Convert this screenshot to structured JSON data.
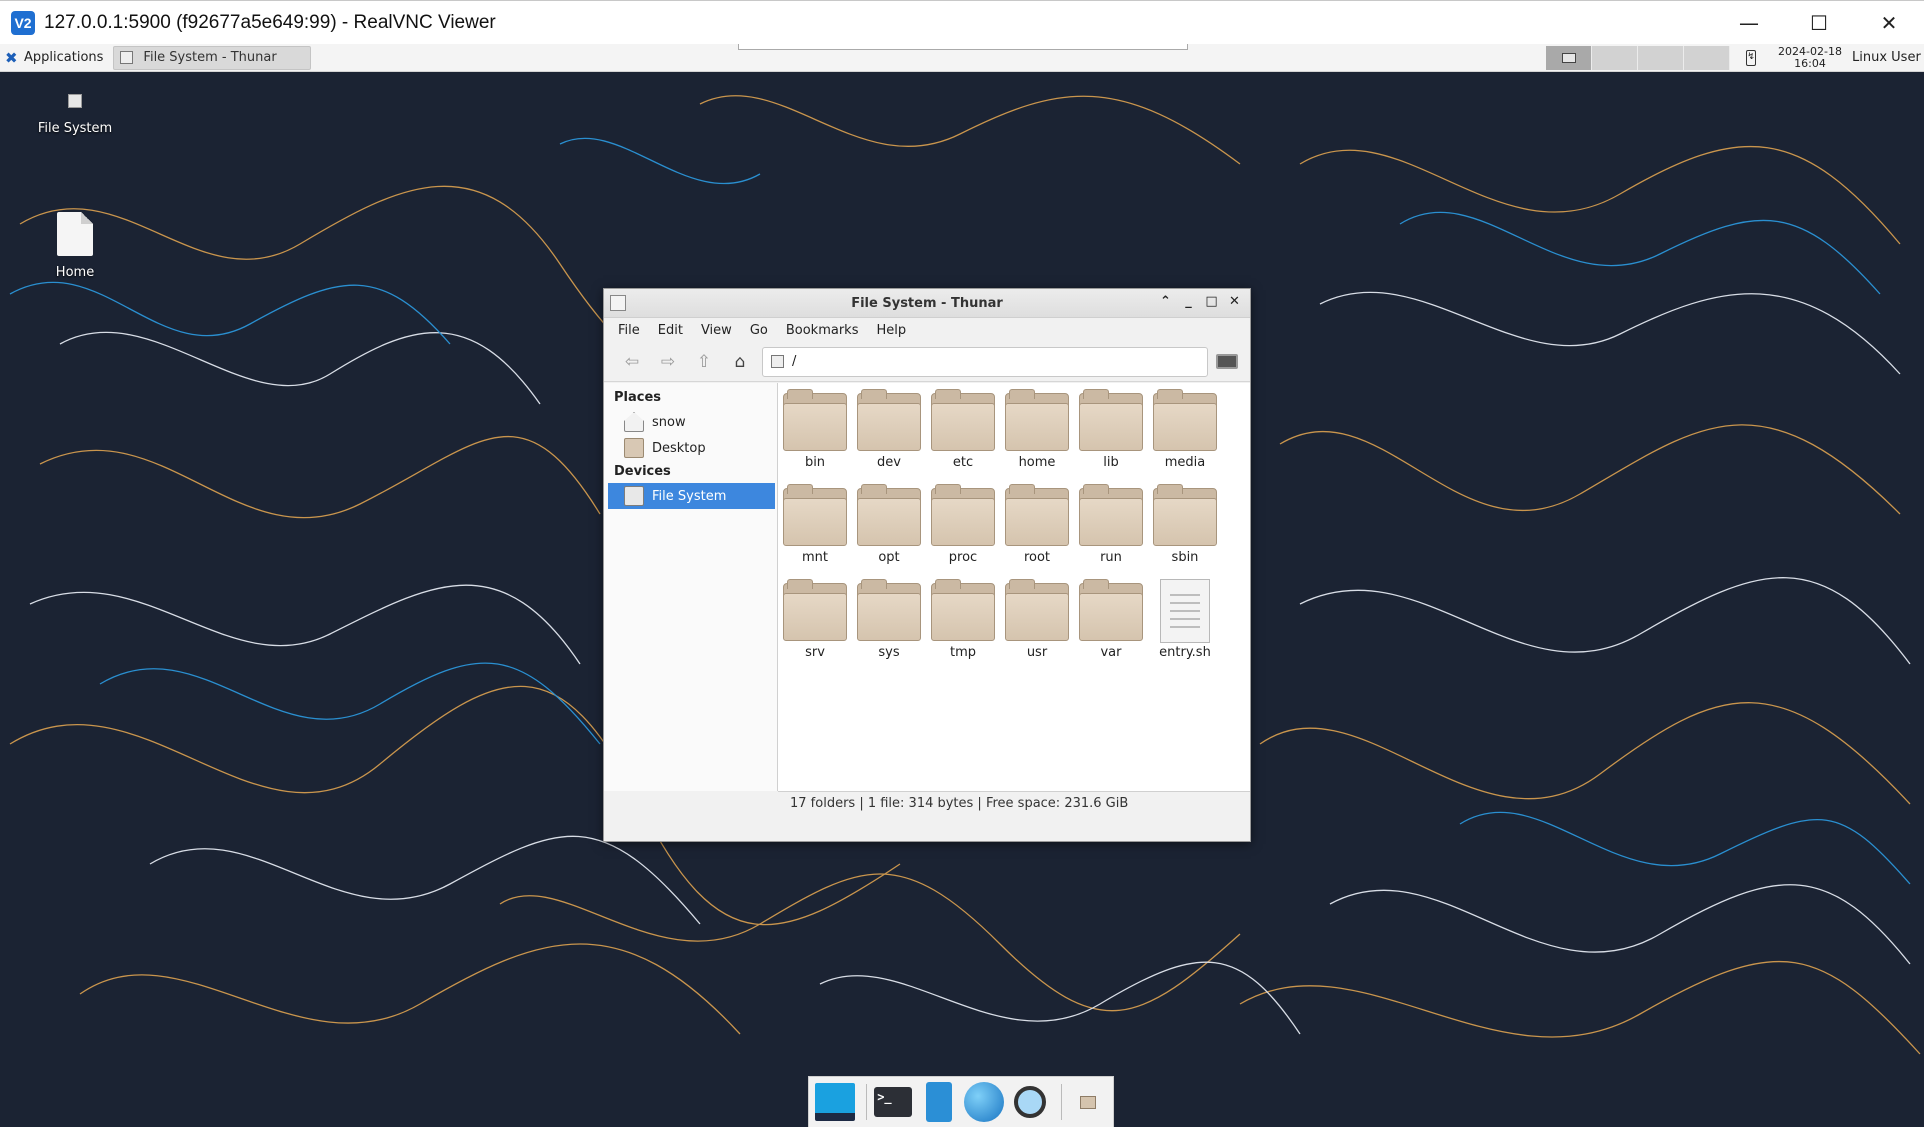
{
  "vnc": {
    "title": "127.0.0.1:5900 (f92677a5e649:99) - RealVNC Viewer",
    "logo_text": "V2"
  },
  "panel": {
    "applications_label": "Applications",
    "task_label": "File System - Thunar",
    "date": "2024-02-18",
    "time": "16:04",
    "user": "Linux User"
  },
  "desktop_icons": {
    "filesystem_label": "File System",
    "home_label": "Home"
  },
  "thunar": {
    "title": "File System - Thunar",
    "menu": [
      "File",
      "Edit",
      "View",
      "Go",
      "Bookmarks",
      "Help"
    ],
    "location": "/",
    "places_header": "Places",
    "places": [
      "snow",
      "Desktop"
    ],
    "devices_header": "Devices",
    "devices": [
      "File System"
    ],
    "folders": [
      "bin",
      "dev",
      "etc",
      "home",
      "lib",
      "media",
      "mnt",
      "opt",
      "proc",
      "root",
      "run",
      "sbin",
      "srv",
      "sys",
      "tmp",
      "usr",
      "var"
    ],
    "file": "entry.sh",
    "status": "17 folders  |  1 file: 314 bytes  |  Free space: 231.6 GiB"
  },
  "colors": {
    "desktop_bg": "#1b2333",
    "selection": "#3d87de",
    "folder": "#d5c4ae"
  }
}
